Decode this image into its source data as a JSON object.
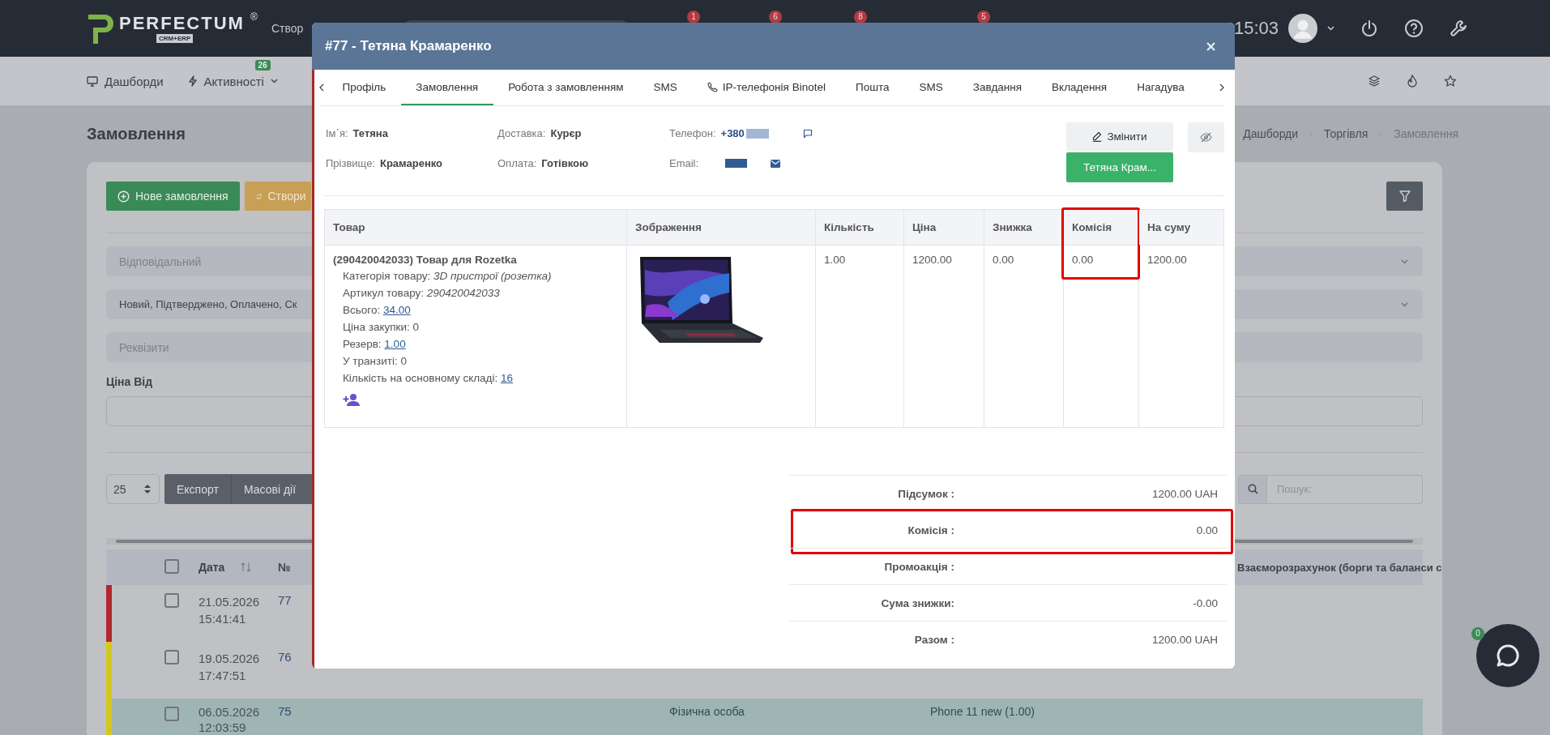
{
  "topbar": {
    "logo": "PERFECTUM",
    "logo_mark": "®",
    "logo_sub": "CRM+ERP",
    "create_label": "Створ",
    "badges": [
      "1",
      "6",
      "8",
      "5"
    ],
    "time": "15:03"
  },
  "navbar": {
    "items": [
      {
        "label": "Дашборди",
        "kind": "monitor"
      },
      {
        "label": "Активності",
        "kind": "bolt",
        "badge": "26"
      }
    ]
  },
  "page": {
    "title": "Замовлення",
    "breadcrumbs": [
      {
        "label": "Дашборди",
        "current": false
      },
      {
        "label": "Торгівля",
        "current": false
      },
      {
        "label": "Замовлення",
        "current": true
      }
    ]
  },
  "actions": [
    {
      "label": "Нове замовлення",
      "kind": "new"
    },
    {
      "label": "Створи",
      "kind": "sync"
    }
  ],
  "filters": {
    "responsible_placeholder": "Відповідальний",
    "statuses": "Новий, Підтверджено, Оплачено, Ск",
    "requisites_placeholder": "Реквізити",
    "price_from_label": "Ціна Від"
  },
  "list_controls": {
    "page_size": "25",
    "buttons": [
      "Експорт",
      "Масові дії"
    ],
    "search_placeholder": "Пошук:"
  },
  "orders_table": {
    "all_checked": false,
    "columns": [
      "Дата",
      "№",
      "Взаєморозрахунок (борги та баланси с"
    ],
    "rows": [
      {
        "date": "21.05.2026",
        "time": "15:41:41",
        "number": "77",
        "color": "#b0282e",
        "checked": false,
        "highlighted": false
      },
      {
        "date": "19.05.2026",
        "time": "17:47:51",
        "number": "76",
        "color": "#d2c81c",
        "checked": false,
        "highlighted": false
      },
      {
        "date": "06.05.2026",
        "time": "12:03:59",
        "number": "75",
        "color": "#d2c81c",
        "checked": false,
        "highlighted": true,
        "customer_type": "Фізична особа",
        "products": "Phone 11 new (1.00)"
      }
    ]
  },
  "chat": {
    "badge": "0"
  },
  "modal": {
    "title": "#77 - Тетяна Крамаренко",
    "tabs": [
      {
        "label": "Профіль",
        "kind": "text",
        "selected": false
      },
      {
        "label": "Замовлення",
        "kind": "text",
        "selected": true
      },
      {
        "label": "Робота з замовленням",
        "kind": "text",
        "selected": false
      },
      {
        "label": "SMS",
        "kind": "text",
        "selected": false
      },
      {
        "label": "IP-телефонія Binotel",
        "kind": "phone",
        "selected": false
      },
      {
        "label": "Пошта",
        "kind": "text",
        "selected": false
      },
      {
        "label": "SMS",
        "kind": "text",
        "selected": false
      },
      {
        "label": "Завдання",
        "kind": "text",
        "selected": false
      },
      {
        "label": "Вкладення",
        "kind": "text",
        "selected": false
      },
      {
        "label": "Нагадува",
        "kind": "text",
        "selected": false
      }
    ],
    "fields": [
      [
        {
          "label": "Ім΄я:",
          "value": "Тетяна",
          "kind": "text"
        },
        {
          "label": "Прізвище:",
          "value": "Крамаренко",
          "kind": "text"
        }
      ],
      [
        {
          "label": "Доставка:",
          "value": "Курєр",
          "kind": "text"
        },
        {
          "label": "Оплата:",
          "value": "Готівкою",
          "kind": "text"
        }
      ],
      [
        {
          "label": "Телефон:",
          "value": "+380",
          "kind": "phone"
        },
        {
          "label": "Email:",
          "kind": "email"
        }
      ]
    ],
    "edit_button": "Змінити",
    "contact_button": "Тетяна Крам...",
    "items_table": {
      "columns": [
        {
          "label": "Товар",
          "highlighted": false
        },
        {
          "label": "Зображення",
          "highlighted": false
        },
        {
          "label": "Кількість",
          "highlighted": false
        },
        {
          "label": "Ціна",
          "highlighted": false
        },
        {
          "label": "Знижка",
          "highlighted": false
        },
        {
          "label": "Комісія",
          "highlighted": true
        },
        {
          "label": "На суму",
          "highlighted": false
        }
      ],
      "rows": [
        {
          "title": "(290420042033) Товар для Rozetka",
          "details": [
            {
              "label": "Категорія товару:",
              "value": "3D пристрої (розетка)",
              "kind": "italic"
            },
            {
              "label": "Артикул товару:",
              "value": "290420042033",
              "kind": "italic"
            },
            {
              "label": "Всього:",
              "value": "34.00",
              "kind": "link"
            },
            {
              "label": "Ціна закупки:",
              "value": "0",
              "kind": "plain"
            },
            {
              "label": "Резерв:",
              "value": "1.00",
              "kind": "link"
            },
            {
              "label": "У транзиті:",
              "value": "0",
              "kind": "plain"
            },
            {
              "label": "Кількість на основному складі:",
              "value": "16",
              "kind": "link"
            }
          ],
          "quantity": "1.00",
          "price": "1200.00",
          "discount": "0.00",
          "commission": "0.00",
          "amount": "1200.00"
        }
      ]
    },
    "summary": [
      {
        "label": "Підсумок :",
        "value": "1200.00 UAH",
        "highlighted": false
      },
      {
        "label": "Комісія :",
        "value": "0.00",
        "highlighted": true
      },
      {
        "label": "Промоакція :",
        "highlighted": false
      },
      {
        "label": "Сума знижки:",
        "value": "-0.00",
        "highlighted": false
      },
      {
        "label": "Разом :",
        "value": "1200.00 UAH",
        "highlighted": false
      }
    ]
  }
}
